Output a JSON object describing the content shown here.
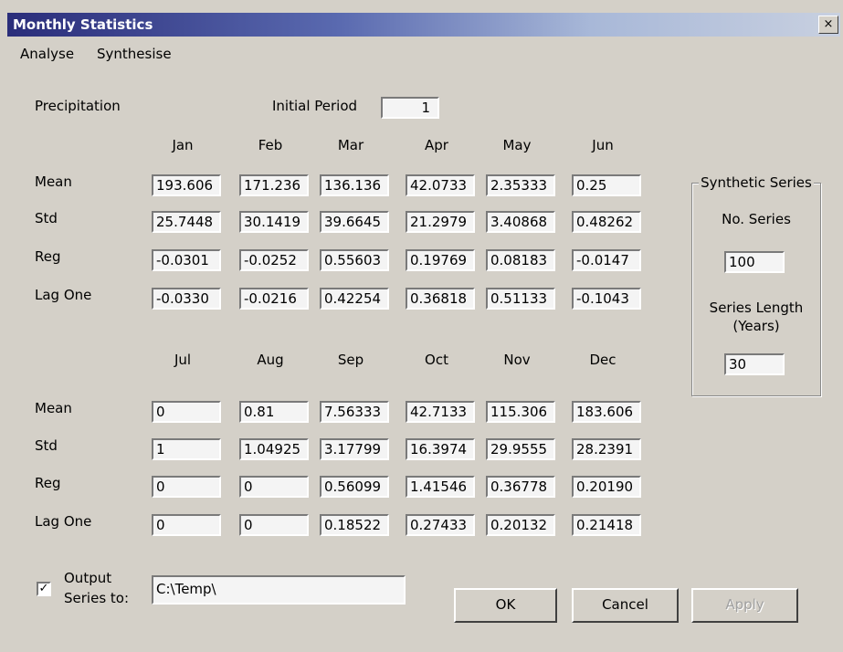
{
  "window": {
    "title": "Monthly Statistics",
    "close_glyph": "×"
  },
  "menu": [
    "Analyse",
    "Synthesise"
  ],
  "variable_label": "Precipitation",
  "initial_period": {
    "label": "Initial Period",
    "value": "1"
  },
  "row_labels": [
    "Mean",
    "Std",
    "Reg",
    "Lag One"
  ],
  "top_months": [
    "Jan",
    "Feb",
    "Mar",
    "Apr",
    "May",
    "Jun"
  ],
  "top_values": [
    [
      "193.606",
      "171.236",
      "136.136",
      "42.0733",
      "2.35333",
      "0.25"
    ],
    [
      "25.7448",
      "30.1419",
      "39.6645",
      "21.2979",
      "3.40868",
      "0.48262"
    ],
    [
      "-0.0301",
      "-0.0252",
      "0.55603",
      "0.19769",
      "0.08183",
      "-0.0147"
    ],
    [
      "-0.0330",
      "-0.0216",
      "0.42254",
      "0.36818",
      "0.51133",
      "-0.1043"
    ]
  ],
  "bottom_months": [
    "Jul",
    "Aug",
    "Sep",
    "Oct",
    "Nov",
    "Dec"
  ],
  "bottom_values": [
    [
      "0",
      "0.81",
      "7.56333",
      "42.7133",
      "115.306",
      "183.606"
    ],
    [
      "1",
      "1.04925",
      "3.17799",
      "16.3974",
      "29.9555",
      "28.2391"
    ],
    [
      "0",
      "0",
      "0.56099",
      "1.41546",
      "0.36778",
      "0.20190"
    ],
    [
      "0",
      "0",
      "0.18522",
      "0.27433",
      "0.20132",
      "0.21418"
    ]
  ],
  "synthetic": {
    "group_title": "Synthetic Series",
    "no_series_label": "No. Series",
    "no_series_value": "100",
    "length_label_1": "Series Length",
    "length_label_2": "(Years)",
    "length_value": "30"
  },
  "output": {
    "checked": true,
    "check_glyph": "✓",
    "label_1": "Output",
    "label_2": "Series to:",
    "path": "C:\\Temp\\"
  },
  "buttons": {
    "ok": "OK",
    "cancel": "Cancel",
    "apply": "Apply"
  }
}
